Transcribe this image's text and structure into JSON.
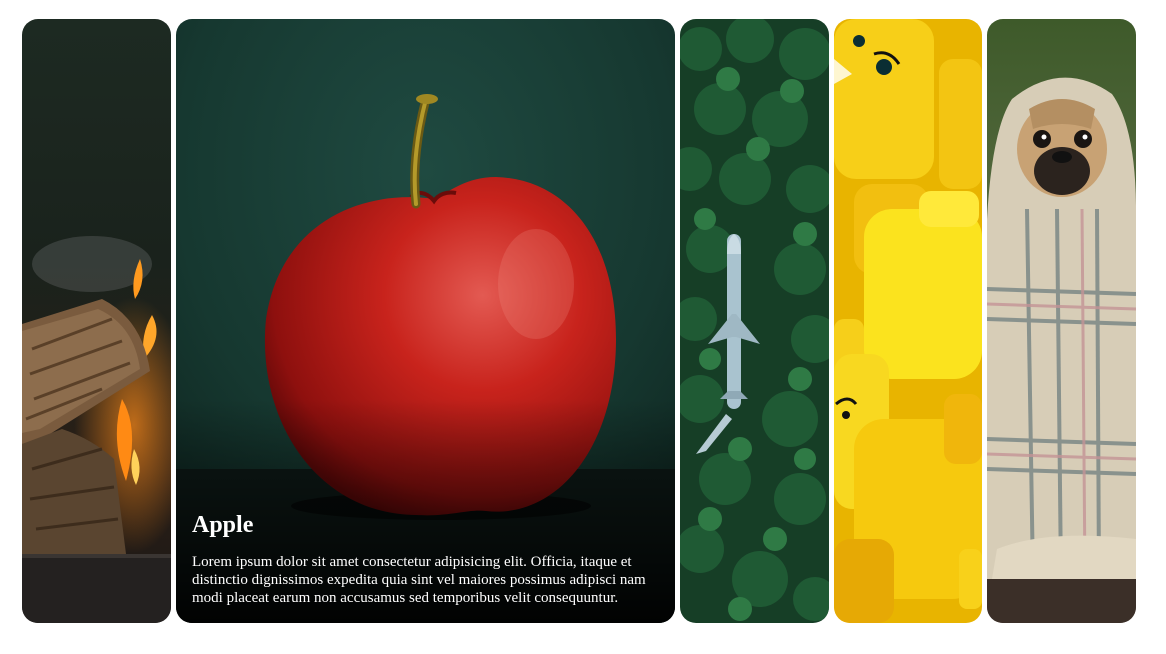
{
  "panels": [
    {
      "id": "campfire",
      "active": false
    },
    {
      "id": "apple",
      "active": true,
      "title": "Apple",
      "description": "Lorem ipsum dolor sit amet consectetur adipisicing elit. Officia, itaque et distinctio dignissimos expedita quia sint vel maiores possimus adipisci nam modi placeat earum non accusamus sed temporibus velit consequuntur."
    },
    {
      "id": "plane-in-forest",
      "active": false
    },
    {
      "id": "toy-figures",
      "active": false
    },
    {
      "id": "pug-in-blanket",
      "active": false
    }
  ]
}
